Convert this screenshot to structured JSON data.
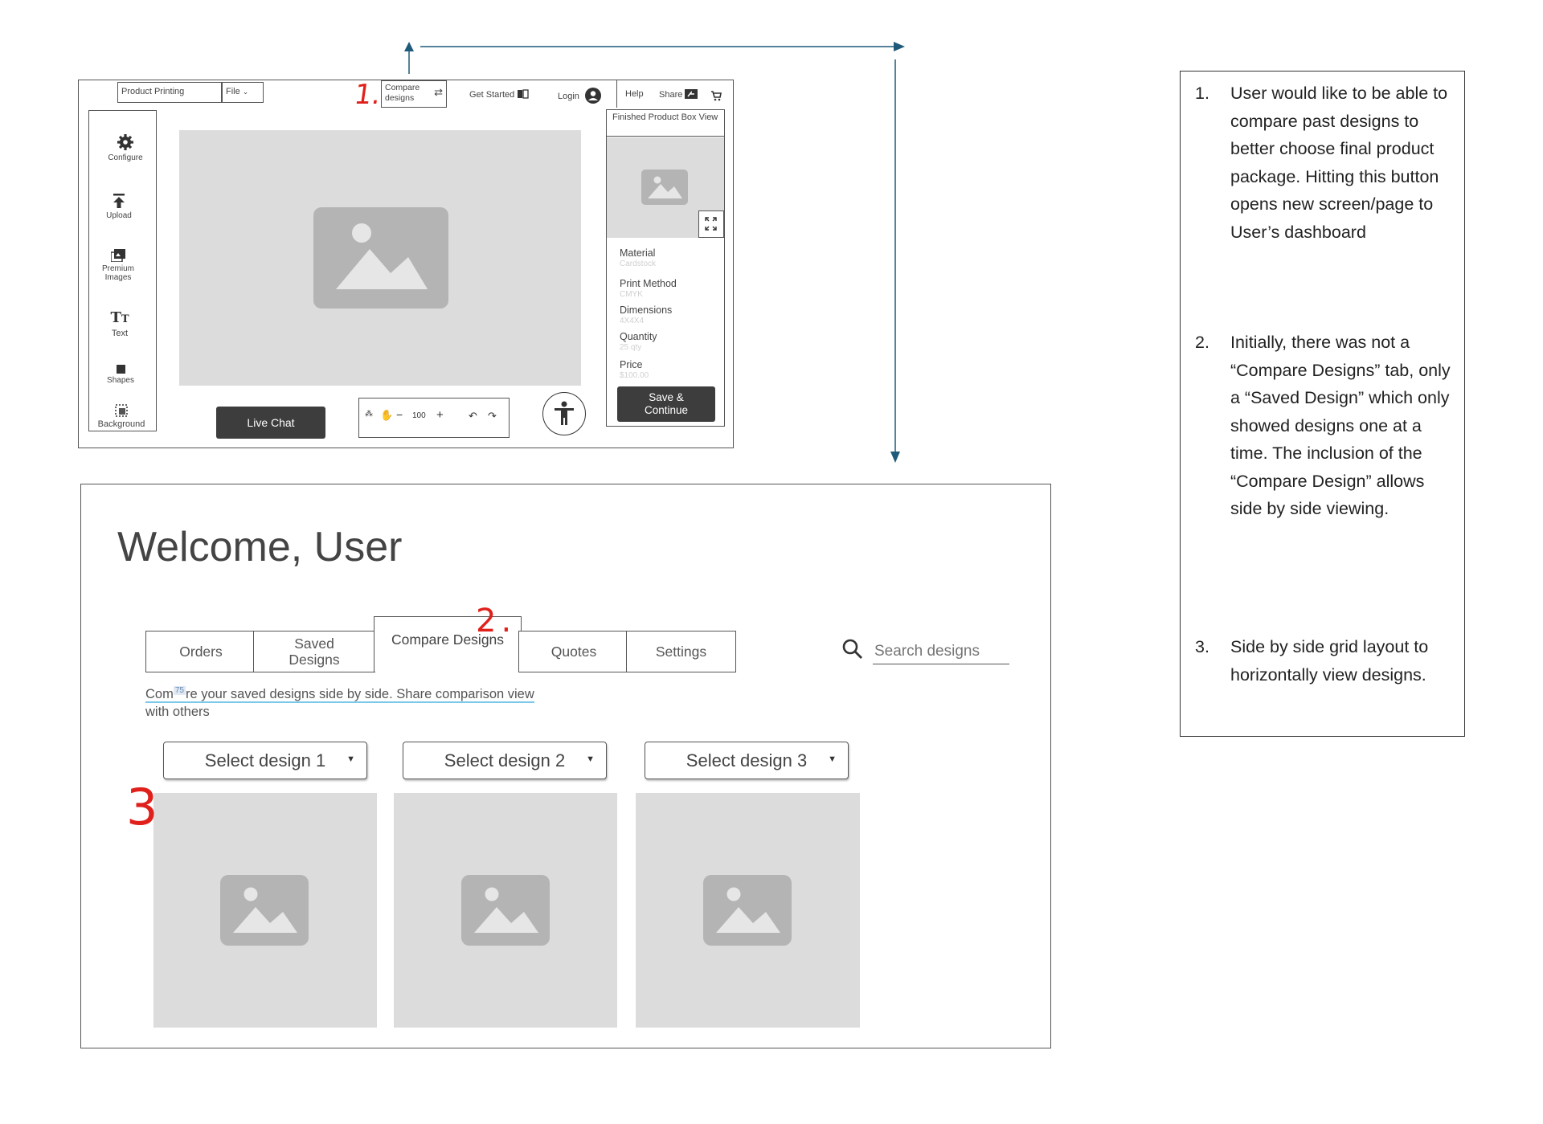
{
  "editor": {
    "product_field": "Product Printing",
    "file_menu": "File",
    "compare_designs": "Compare designs",
    "get_started": "Get Started",
    "login": "Login",
    "help": "Help",
    "share": "Share",
    "preview_title": "Finished Product Box View",
    "sidebar": [
      {
        "label": "Configure",
        "icon": "gear-icon"
      },
      {
        "label": "Upload",
        "icon": "upload-icon"
      },
      {
        "label": "Premium Images",
        "icon": "images-icon"
      },
      {
        "label": "Text",
        "icon": "text-icon"
      },
      {
        "label": "Shapes",
        "icon": "square-icon"
      },
      {
        "label": "Background",
        "icon": "background-icon"
      }
    ],
    "specs": [
      {
        "label": "Material",
        "value": "Cardstock"
      },
      {
        "label": "Print Method",
        "value": "CMYK"
      },
      {
        "label": "Dimensions",
        "value": "4X4X4"
      },
      {
        "label": "Quantity",
        "value": "25 qty"
      },
      {
        "label": "Price",
        "value": "$100.00"
      }
    ],
    "save_button": "Save & Continue",
    "live_chat": "Live Chat",
    "zoom": "100"
  },
  "dashboard": {
    "welcome": "Welcome, User",
    "tabs": [
      {
        "label": "Orders"
      },
      {
        "label": "Saved Designs"
      },
      {
        "label": "Compare Designs"
      },
      {
        "label": "Quotes"
      },
      {
        "label": "Settings"
      }
    ],
    "search_placeholder": "Search designs",
    "description_part1": "Com",
    "description_badge": "75",
    "description_part2": "re your saved designs side by side. Share comparison view",
    "description_line2": "with others",
    "selects": [
      "Select design 1",
      "Select design 2",
      "Select design 3"
    ]
  },
  "annotations": {
    "marker1": "1.",
    "marker2": "2.",
    "marker3": "3"
  },
  "notes": [
    {
      "num": "1.",
      "text": "User would like to be able to compare past designs to better choose final product package. Hitting this button opens new screen/page to User’s dashboard"
    },
    {
      "num": "2.",
      "text": "Initially, there was not a “Compare Designs” tab, only a “Saved Design” which only showed designs one at a time. The inclusion of the “Compare Design” allows side by side viewing."
    },
    {
      "num": "3.",
      "text": "Side by side grid layout to horizontally view designs."
    }
  ],
  "colors": {
    "arrow": "#1f5a7a",
    "annotation_red": "#e0201b",
    "placeholder": "#dcdcdc",
    "button_dark": "#3d3d3d"
  }
}
